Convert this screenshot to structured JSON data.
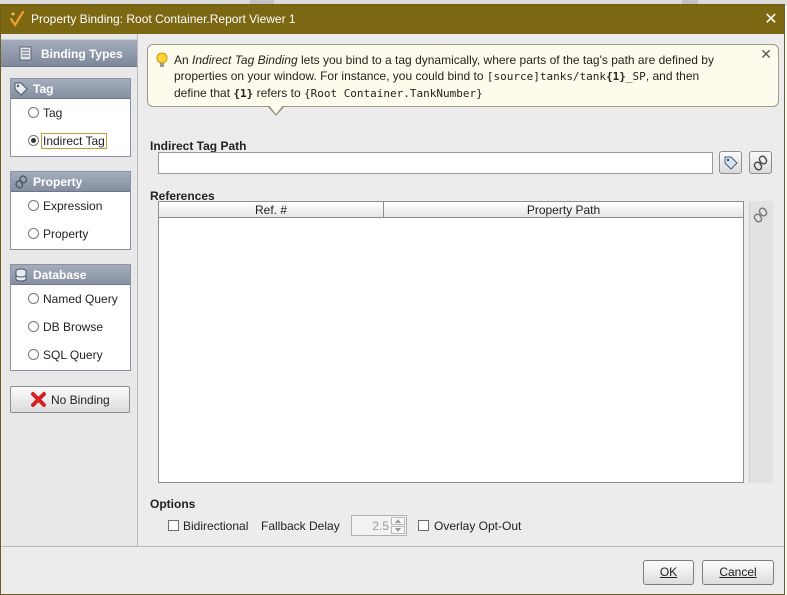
{
  "window": {
    "title": "Property Binding: Root Container.Report Viewer 1",
    "close_glyph": "✕"
  },
  "left_panel": {
    "header": "Binding Types",
    "groups": [
      {
        "title": "Tag",
        "icon": "tag-icon",
        "options": [
          {
            "label": "Tag",
            "selected": false
          },
          {
            "label": "Indirect Tag",
            "selected": true
          }
        ]
      },
      {
        "title": "Property",
        "icon": "link-icon",
        "options": [
          {
            "label": "Expression",
            "selected": false
          },
          {
            "label": "Property",
            "selected": false
          }
        ]
      },
      {
        "title": "Database",
        "icon": "database-icon",
        "options": [
          {
            "label": "Named Query",
            "selected": false
          },
          {
            "label": "DB Browse",
            "selected": false
          },
          {
            "label": "SQL Query",
            "selected": false
          }
        ]
      }
    ],
    "no_binding_label": "No Binding"
  },
  "tip": {
    "line1_a": "An ",
    "line1_em": "Indirect Tag Binding",
    "line1_b": " lets you bind to a tag dynamically, where parts of the tag's path are defined by",
    "line2_a": "properties on your window. For instance, you could bind to ",
    "line2_code": "[source]tanks/tank",
    "line2_code_bold": "{1}",
    "line2_code_end": "_SP",
    "line2_b": ", and then",
    "line3_a": "define that ",
    "line3_code_bold": "{1}",
    "line3_b": " refers to ",
    "line3_code": "{Root Container.TankNumber}",
    "close_glyph": "✕"
  },
  "indirect_tag_path": {
    "label": "Indirect Tag Path",
    "value": ""
  },
  "references": {
    "label": "References",
    "columns": [
      "Ref. #",
      "Property Path"
    ],
    "rows": []
  },
  "options": {
    "label": "Options",
    "bidirectional_label": "Bidirectional",
    "bidirectional_checked": false,
    "fallback_delay_label": "Fallback Delay",
    "fallback_delay_value": "2.5",
    "overlay_opt_out_label": "Overlay Opt-Out",
    "overlay_opt_out_checked": false
  },
  "buttons": {
    "ok": "OK",
    "cancel": "Cancel"
  },
  "colors": {
    "titlebar": "#7c6712",
    "header_gradient_top": "#a4adbc",
    "tip_background": "#fdfcec"
  }
}
